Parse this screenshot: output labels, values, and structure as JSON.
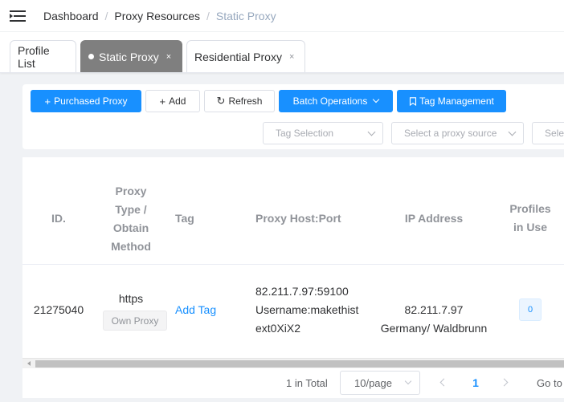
{
  "breadcrumb": [
    "Dashboard",
    "Proxy Resources",
    "Static Proxy"
  ],
  "breadcrumb_sep": "/",
  "tabs": [
    {
      "label": "Profile List"
    },
    {
      "label": "Static Proxy",
      "close": "×"
    },
    {
      "label": "Residential Proxy",
      "close": "×"
    }
  ],
  "toolbar": {
    "purchased": {
      "icon": "+",
      "label": "Purchased Proxy"
    },
    "add": {
      "icon": "+",
      "label": "Add"
    },
    "refresh": {
      "icon": "↻",
      "label": "Refresh"
    },
    "batch": {
      "label": "Batch Operations"
    },
    "tag_mgmt": {
      "icon": "bookmark-icon",
      "label": "Tag Management"
    }
  },
  "filters": {
    "tag_selection": "Tag Selection",
    "proxy_source": "Select a proxy source",
    "third": "Sele"
  },
  "table": {
    "headers": {
      "id": "ID.",
      "proxy_type": [
        "Proxy",
        "Type /",
        "Obtain",
        "Method"
      ],
      "tag": "Tag",
      "host_port": "Proxy Host:Port",
      "ip_address": "IP Address",
      "profiles": [
        "Profiles",
        "in Use"
      ]
    },
    "rows": [
      {
        "id": "21275040",
        "type": "https",
        "obtain": "Own Proxy",
        "tag_action": "Add Tag",
        "host_lines": [
          "82.211.7.97:59100",
          "Username:makethist",
          "ext0XiX2"
        ],
        "ip": "82.211.7.97",
        "location": "Germany/ Waldbrunn",
        "profiles_in_use": "0"
      }
    ]
  },
  "pagination": {
    "total": "1 in Total",
    "page_size": "10/page",
    "current_page": "1",
    "goto": "Go to"
  },
  "colors": {
    "primary": "#1890ff",
    "active_tab": "#7f7f7f"
  }
}
